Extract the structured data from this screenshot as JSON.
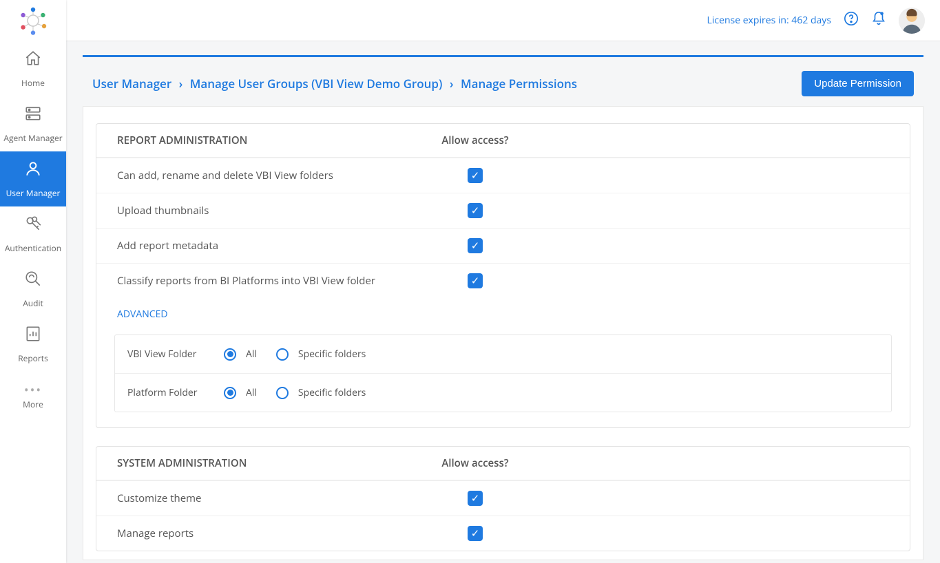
{
  "sidebar": {
    "items": [
      {
        "label": "Home"
      },
      {
        "label": "Agent Manager"
      },
      {
        "label": "User Manager"
      },
      {
        "label": "Authentication"
      },
      {
        "label": "Audit"
      },
      {
        "label": "Reports"
      },
      {
        "label": "More"
      }
    ]
  },
  "topbar": {
    "license_text": "License expires in: 462 days"
  },
  "breadcrumb": {
    "level1": "User Manager",
    "level2": "Manage User Groups  (VBI View Demo Group)",
    "level3": "Manage Permissions"
  },
  "buttons": {
    "update_permission": "Update Permission"
  },
  "sections": {
    "report_admin": {
      "title": "REPORT ADMINISTRATION",
      "access_label": "Allow access?",
      "rows": [
        {
          "label": "Can add, rename and delete VBI View folders",
          "checked": true
        },
        {
          "label": "Upload thumbnails",
          "checked": true
        },
        {
          "label": "Add report metadata",
          "checked": true
        },
        {
          "label": "Classify reports from BI Platforms into VBI View folder",
          "checked": true
        }
      ],
      "advanced_label": "ADVANCED",
      "advanced_rows": [
        {
          "label": "VBI View Folder",
          "options": [
            {
              "label": "All",
              "selected": true
            },
            {
              "label": "Specific folders",
              "selected": false
            }
          ]
        },
        {
          "label": "Platform Folder",
          "options": [
            {
              "label": "All",
              "selected": true
            },
            {
              "label": "Specific folders",
              "selected": false
            }
          ]
        }
      ]
    },
    "system_admin": {
      "title": "SYSTEM ADMINISTRATION",
      "access_label": "Allow access?",
      "rows": [
        {
          "label": "Customize theme",
          "checked": true
        },
        {
          "label": "Manage reports",
          "checked": true
        }
      ]
    }
  }
}
